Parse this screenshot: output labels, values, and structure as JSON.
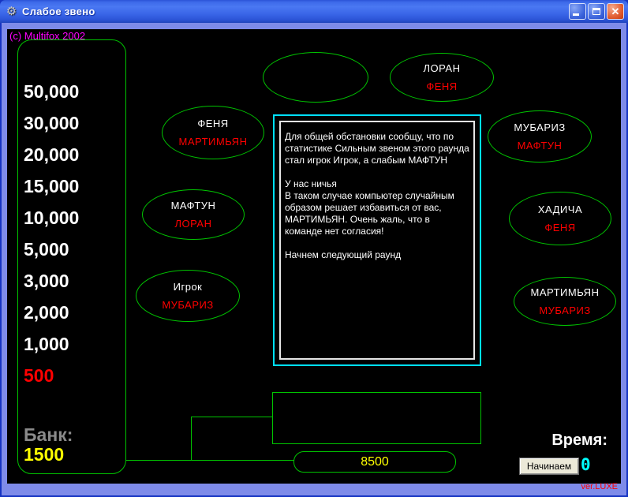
{
  "window": {
    "title": "Слабое звено",
    "controls": {
      "close_glyph": "✕"
    },
    "app_icon_glyph": "⚙"
  },
  "copyright": "(c) Multifox 2002",
  "money_ladder": {
    "values": [
      "50,000",
      "30,000",
      "20,000",
      "15,000",
      "10,000",
      "5,000",
      "3,000",
      "2,000",
      "1,000",
      "500"
    ],
    "bank_label": "Банк:",
    "bank_value": "1500"
  },
  "players": [
    {
      "name": "ФЕНЯ",
      "vote": "МАРТИМЬЯН"
    },
    {
      "name": "МАФТУН",
      "vote": "ЛОРАН"
    },
    {
      "name": "Игрок",
      "vote": "МУБАРИЗ"
    },
    {
      "name": "",
      "vote": ""
    },
    {
      "name": "ЛОРАН",
      "vote": "ФЕНЯ"
    },
    {
      "name": "МУБАРИЗ",
      "vote": "МАФТУН"
    },
    {
      "name": "ХАДИЧА",
      "vote": "ФЕНЯ"
    },
    {
      "name": "МАРТИМЬЯН",
      "vote": "МУБАРИЗ"
    }
  ],
  "message": {
    "text": "Для общей обстановки сообщу, что по статистике Сильным звеном этого раунда стал игрок Игрок, а слабым МАФТУН\n\nУ нас ничья\nВ таком случае компьютер случайным образом решает избавиться от вас, МАРТИМЬЯН. Очень жаль, что в команде нет согласия!\n\nНачнем следующий раунд"
  },
  "round_money": "8500",
  "timer": {
    "label": "Время:",
    "value": "0"
  },
  "buttons": {
    "start": "Начинаем"
  },
  "version": "ver.LUXE",
  "colors": {
    "line_green": "#00c400",
    "vote_red": "#ff0000",
    "bank_yellow": "#ffff00",
    "copyright_magenta": "#ff00ff",
    "timer_cyan": "#00ffff",
    "bank_label_gray": "#8a8a8a",
    "message_border_cyan": "#00e1ff"
  }
}
